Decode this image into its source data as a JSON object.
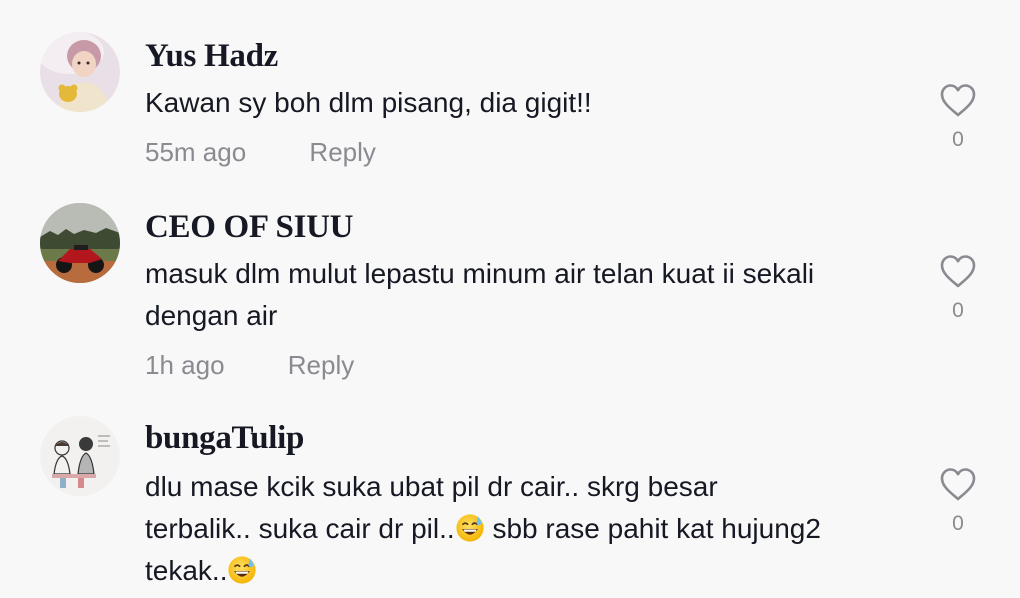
{
  "comments": [
    {
      "username": "Yus Hadz",
      "text": "Kawan sy boh dlm pisang, dia gigit!!",
      "time": "55m ago",
      "reply_label": "Reply",
      "like_count": "0",
      "avatar_icon": "child-photo-avatar"
    },
    {
      "username": "CEO OF SIUU",
      "text": "masuk dlm mulut lepastu minum air telan kuat ii sekali dengan air",
      "time": "1h ago",
      "reply_label": "Reply",
      "like_count": "0",
      "avatar_icon": "motorcycle-photo-avatar"
    },
    {
      "username": "bungaTulip",
      "text_parts": [
        "dlu mase kcik suka ubat pil dr cair.. skrg besar terbalik.. suka cair dr pil..",
        " sbb rase pahit kat hujung2 tekak.."
      ],
      "emoji": "grinning-sweat-emoji",
      "like_count": "0",
      "avatar_icon": "sketch-drawing-avatar"
    }
  ],
  "colors": {
    "background": "#f8f8f8",
    "username": "#161823",
    "body_text": "#161823",
    "meta_text": "#8a8b91",
    "heart_outline": "#8a8b91"
  }
}
